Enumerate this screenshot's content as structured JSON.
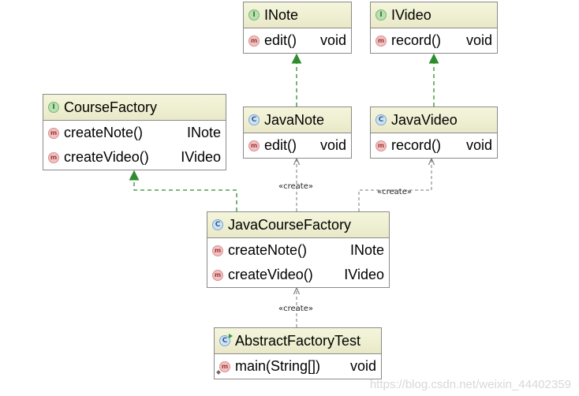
{
  "classes": {
    "inote": {
      "kind": "I",
      "name": "INote",
      "methods": [
        {
          "kind": "m",
          "name": "edit()",
          "type": "void"
        }
      ]
    },
    "ivideo": {
      "kind": "I",
      "name": "IVideo",
      "methods": [
        {
          "kind": "m",
          "name": "record()",
          "type": "void"
        }
      ]
    },
    "course_factory": {
      "kind": "I",
      "name": "CourseFactory",
      "methods": [
        {
          "kind": "m",
          "name": "createNote()",
          "type": "INote"
        },
        {
          "kind": "m",
          "name": "createVideo()",
          "type": "IVideo"
        }
      ]
    },
    "java_note": {
      "kind": "C",
      "name": "JavaNote",
      "methods": [
        {
          "kind": "m",
          "name": "edit()",
          "type": "void"
        }
      ]
    },
    "java_video": {
      "kind": "C",
      "name": "JavaVideo",
      "methods": [
        {
          "kind": "m",
          "name": "record()",
          "type": "void"
        }
      ]
    },
    "java_course_factory": {
      "kind": "C",
      "name": "JavaCourseFactory",
      "methods": [
        {
          "kind": "m",
          "name": "createNote()",
          "type": "INote"
        },
        {
          "kind": "m",
          "name": "createVideo()",
          "type": "IVideo"
        }
      ]
    },
    "abstract_factory_test": {
      "kind": "C",
      "name": "AbstractFactoryTest",
      "methods": [
        {
          "kind": "m",
          "name": "main(String[])",
          "type": "void"
        }
      ]
    }
  },
  "relations": {
    "create_label": "«create»"
  },
  "colors": {
    "realization": "#2e8b2e",
    "dependency": "#7a7a7a",
    "header_bg": "#f2f2d6"
  },
  "watermark": "https://blog.csdn.net/weixin_44402359"
}
